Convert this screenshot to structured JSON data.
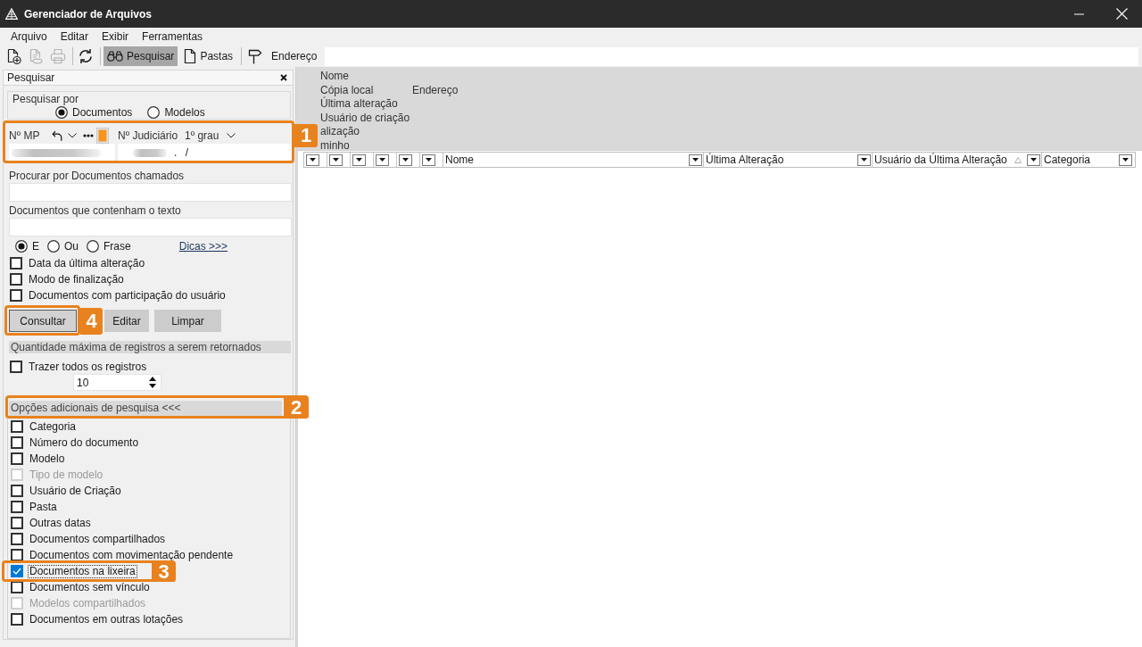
{
  "window": {
    "title": "Gerenciador de Arquivos"
  },
  "menu": [
    {
      "label": "Arquivo"
    },
    {
      "label": "Editar"
    },
    {
      "label": "Exibir"
    },
    {
      "label": "Ferramentas"
    }
  ],
  "toolbar": {
    "buttons": [
      {
        "disabled": false
      },
      {
        "disabled": true
      },
      {
        "disabled": true
      },
      {
        "disabled": false
      }
    ],
    "views": [
      {
        "label": "Pesquisar",
        "selected": true
      },
      {
        "label": "Pastas",
        "selected": false
      }
    ],
    "address": {
      "label": "Endereço"
    }
  },
  "search_panel": {
    "title": "Pesquisar",
    "search_by": {
      "label": "Pesquisar por",
      "options": [
        {
          "label": "Documentos",
          "selected": true
        },
        {
          "label": "Modelos",
          "selected": false
        }
      ]
    },
    "numbers": {
      "callout": "1",
      "mp_label": "Nº MP",
      "judicial_label": "Nº Judiciário",
      "instance": "1º grau",
      "mp_field": {
        "redacted": true
      },
      "judicial_field": {
        "redacted": true,
        "value": ". /"
      }
    },
    "name_search": {
      "label": "Procurar por Documentos chamados"
    },
    "text_search": {
      "label": "Documentos que contenham o texto"
    },
    "match_mode": {
      "options": [
        {
          "label": "E",
          "selected": true
        },
        {
          "label": "Ou",
          "selected": false
        },
        {
          "label": "Frase",
          "selected": false
        }
      ],
      "tips_link": "Dicas >>>"
    },
    "filters": [
      {
        "label": "Data da última alteração",
        "checked": false
      },
      {
        "label": "Modo de finalização",
        "checked": false
      },
      {
        "label": "Documentos com participação do usuário",
        "checked": false
      }
    ],
    "actions": [
      {
        "label": "Consultar",
        "focused": true,
        "callout": "4"
      },
      {
        "label": "Editar",
        "focused": false
      },
      {
        "label": "Limpar",
        "focused": false
      }
    ],
    "max_records": {
      "header": "Quantidade máxima de registros a serem retornados",
      "all_records": {
        "label": "Trazer todos os registros",
        "checked": false
      },
      "limit": "10"
    },
    "additional": {
      "header": "Opções adicionais de pesquisa <<<",
      "callout": "2",
      "options": [
        {
          "label": "Categoria",
          "checked": false,
          "disabled": false,
          "focused": false
        },
        {
          "label": "Número do documento",
          "checked": false,
          "disabled": false,
          "focused": false
        },
        {
          "label": "Modelo",
          "checked": false,
          "disabled": false,
          "focused": false
        },
        {
          "label": "Tipo de modelo",
          "checked": false,
          "disabled": true,
          "focused": false
        },
        {
          "label": "Usuário de Criação",
          "checked": false,
          "disabled": false,
          "focused": false
        },
        {
          "label": "Pasta",
          "checked": false,
          "disabled": false,
          "focused": false
        },
        {
          "label": "Outras datas",
          "checked": false,
          "disabled": false,
          "focused": false
        },
        {
          "label": "Documentos compartilhados",
          "checked": false,
          "disabled": false,
          "focused": false
        },
        {
          "label": "Documentos com movimentação pendente",
          "checked": false,
          "disabled": false,
          "focused": false
        },
        {
          "label": "Documentos na lixeira",
          "checked": true,
          "disabled": false,
          "focused": true,
          "callout": "3"
        },
        {
          "label": "Documentos sem vínculo",
          "checked": false,
          "disabled": false,
          "focused": false
        },
        {
          "label": "Modelos compartilhados",
          "checked": false,
          "disabled": true,
          "focused": false
        },
        {
          "label": "Documentos em outras lotações",
          "checked": false,
          "disabled": false,
          "focused": false
        }
      ]
    }
  },
  "fields_panel": {
    "rows": [
      {
        "column_1": "Nome"
      },
      {
        "column_1": "Cópia local",
        "column_2": "Endereço"
      },
      {
        "column_1": "Última alteração"
      },
      {
        "column_1": "Usuário de criação"
      },
      {
        "column_1": "alização"
      },
      {
        "column_1": "minho"
      }
    ]
  },
  "table": {
    "columns": [
      {
        "kind": "blank"
      },
      {
        "kind": "blank"
      },
      {
        "kind": "blank"
      },
      {
        "kind": "blank"
      },
      {
        "kind": "blank"
      },
      {
        "kind": "blank"
      },
      {
        "kind": "named",
        "label": "Nome",
        "sorted": false
      },
      {
        "kind": "named",
        "label": "Última Alteração",
        "sorted": false
      },
      {
        "kind": "named",
        "label": "Usuário da Última Alteração",
        "sorted": true
      },
      {
        "kind": "named",
        "label": "Categoria",
        "sorted": false
      }
    ]
  }
}
